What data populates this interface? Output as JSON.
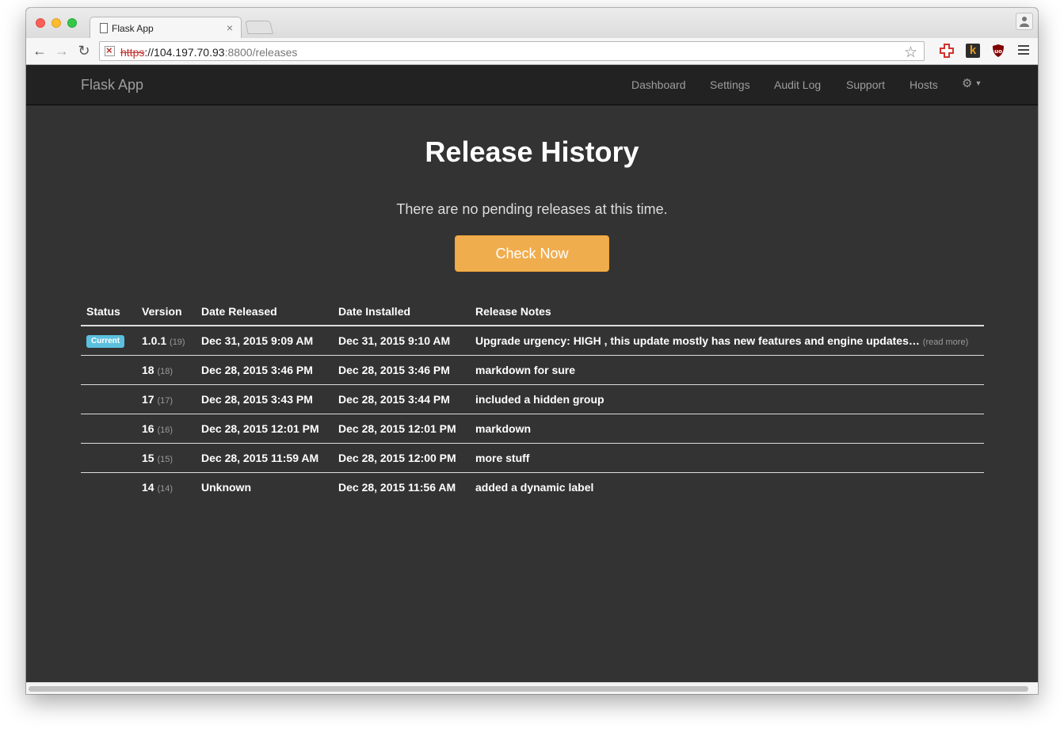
{
  "browser": {
    "tab_title": "Flask App",
    "tab_close": "×",
    "url_scheme": "https",
    "url_host": "://104.197.70.93",
    "url_path": ":8800/releases"
  },
  "navbar": {
    "brand": "Flask App",
    "links": [
      "Dashboard",
      "Settings",
      "Audit Log",
      "Support",
      "Hosts"
    ]
  },
  "page": {
    "title": "Release History",
    "lead": "There are no pending releases at this time.",
    "check_button": "Check Now"
  },
  "table": {
    "headers": [
      "Status",
      "Version",
      "Date Released",
      "Date Installed",
      "Release Notes"
    ],
    "rows": [
      {
        "status": "Current",
        "version": "1.0.1",
        "seq": "(19)",
        "released": "Dec 31, 2015 9:09 AM",
        "installed": "Dec 31, 2015 9:10 AM",
        "notes": "Upgrade urgency: HIGH , this update mostly has new features and engine updates…",
        "read_more": "(read more)"
      },
      {
        "status": "",
        "version": "18",
        "seq": "(18)",
        "released": "Dec 28, 2015 3:46 PM",
        "installed": "Dec 28, 2015 3:46 PM",
        "notes": "markdown for sure",
        "read_more": ""
      },
      {
        "status": "",
        "version": "17",
        "seq": "(17)",
        "released": "Dec 28, 2015 3:43 PM",
        "installed": "Dec 28, 2015 3:44 PM",
        "notes": "included a hidden group",
        "read_more": ""
      },
      {
        "status": "",
        "version": "16",
        "seq": "(16)",
        "released": "Dec 28, 2015 12:01 PM",
        "installed": "Dec 28, 2015 12:01 PM",
        "notes": "markdown",
        "read_more": ""
      },
      {
        "status": "",
        "version": "15",
        "seq": "(15)",
        "released": "Dec 28, 2015 11:59 AM",
        "installed": "Dec 28, 2015 12:00 PM",
        "notes": "more stuff",
        "read_more": ""
      },
      {
        "status": "",
        "version": "14",
        "seq": "(14)",
        "released": "Unknown",
        "installed": "Dec 28, 2015 11:56 AM",
        "notes": "added a dynamic label",
        "read_more": ""
      }
    ]
  },
  "colors": {
    "background": "#333333",
    "navbar": "#222222",
    "warning_button": "#f0ad4e",
    "label_info": "#5bc0de"
  },
  "icons": {
    "back": "arrow-left-icon",
    "forward": "arrow-right-icon",
    "reload": "reload-icon",
    "bookmark": "star-icon",
    "settings": "gear-icon"
  }
}
